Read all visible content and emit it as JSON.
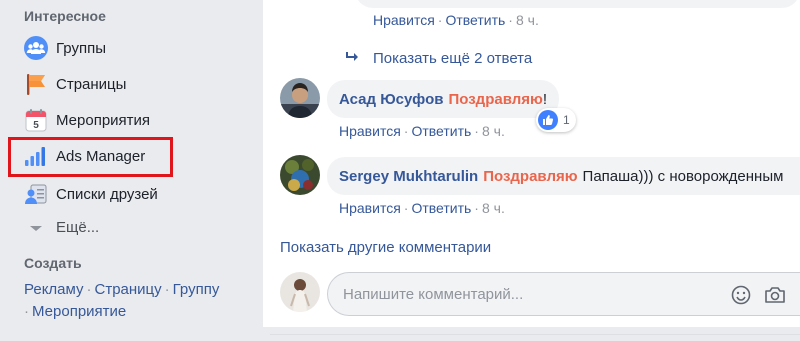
{
  "sidebar": {
    "section_title": "Интересное",
    "items": [
      {
        "label": "Группы",
        "icon": "groups-icon"
      },
      {
        "label": "Страницы",
        "icon": "pages-flag-icon"
      },
      {
        "label": "Мероприятия",
        "icon": "calendar-icon"
      },
      {
        "label": "Ads Manager",
        "icon": "ads-manager-bars-icon"
      },
      {
        "label": "Списки друзей",
        "icon": "friend-lists-icon"
      },
      {
        "label": "Ещё...",
        "icon": "caret-down-icon"
      }
    ],
    "create": {
      "title": "Создать",
      "links": [
        "Рекламу",
        "Страницу",
        "Группу",
        "Мероприятие"
      ]
    }
  },
  "feed": {
    "actions": {
      "like": "Нравится",
      "reply": "Ответить"
    },
    "top_comment": {
      "time": "8 ч."
    },
    "more_replies": "Показать ещё 2 ответа",
    "comments": [
      {
        "author": "Асад Юсуфов",
        "mention": "Поздравляю",
        "text": "!",
        "time": "8 ч.",
        "likes": "1"
      },
      {
        "author": "Sergey Mukhtarulin",
        "mention": "Поздравляю",
        "text": "Папаша))) с новорожденным",
        "time": "8 ч."
      }
    ],
    "show_other": "Показать другие комментарии",
    "composer": {
      "placeholder": "Напишите комментарий..."
    }
  },
  "colors": {
    "link": "#365899",
    "mention": "#e9654b",
    "highlight": "#e0151c",
    "like_blue": "#4080ff"
  }
}
